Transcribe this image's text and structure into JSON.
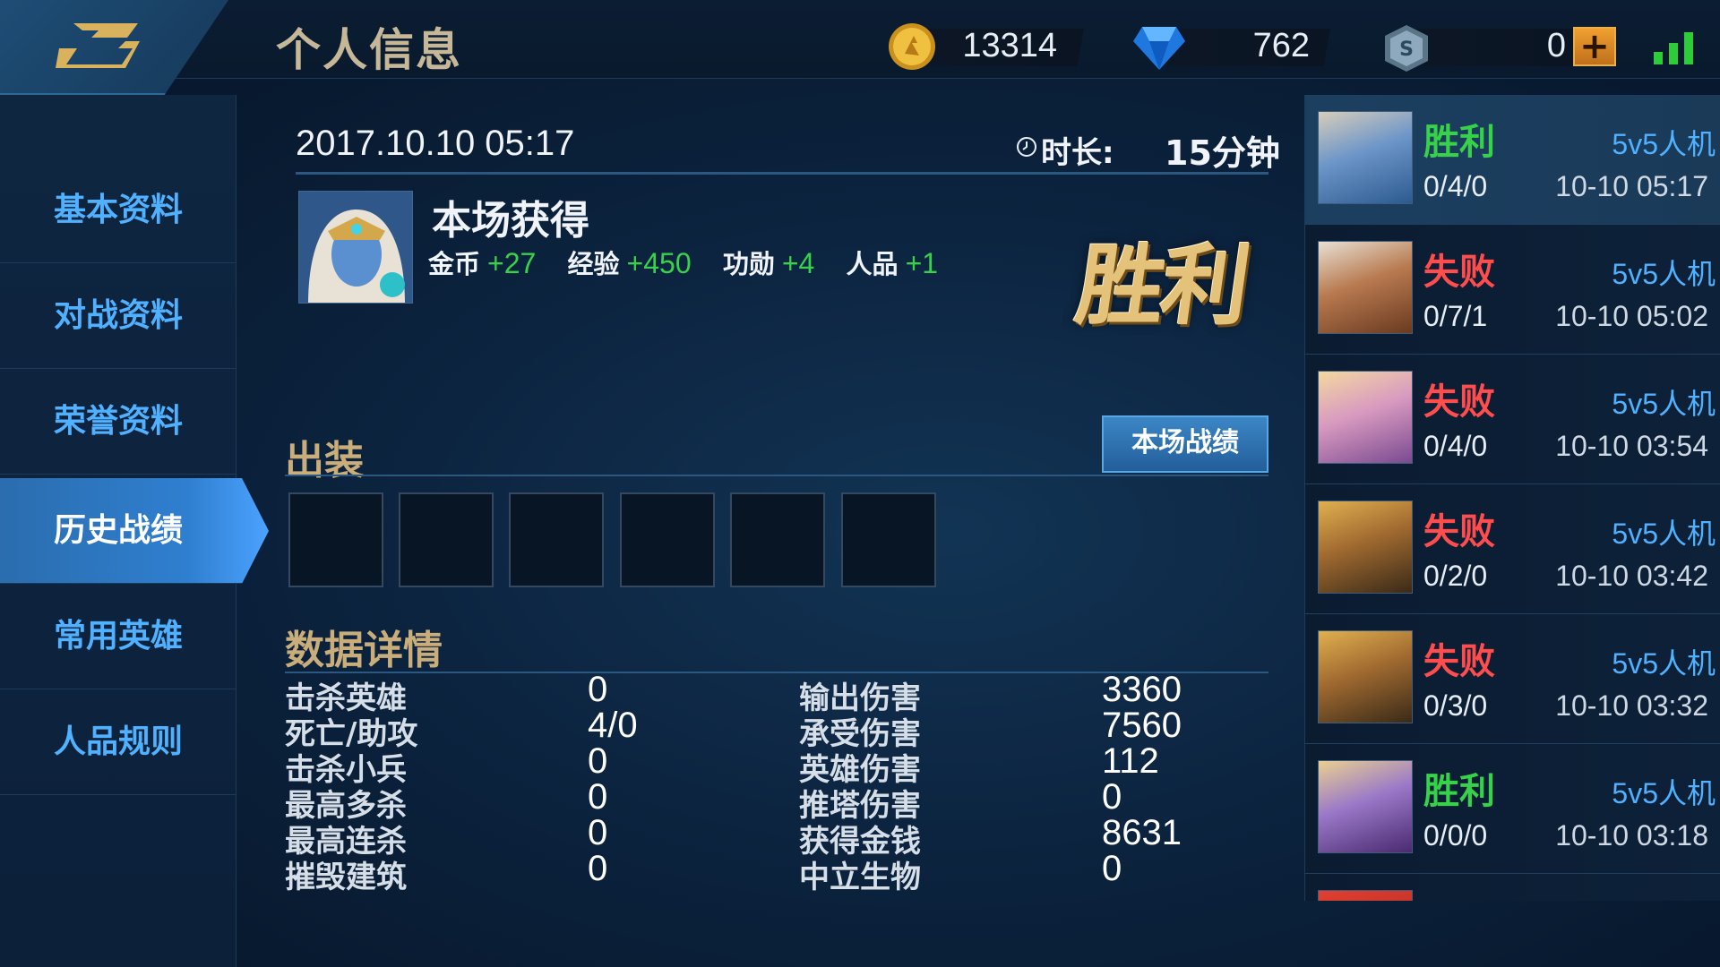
{
  "header": {
    "title": "个人信息",
    "gold": "13314",
    "diamonds": "762",
    "vouchers": "0",
    "add_label": "+"
  },
  "colors": {
    "win": "#37d14a",
    "loss": "#ff4d4d",
    "accent_blue": "#4fb1ff",
    "gold_title": "#c9ad7a"
  },
  "nav": {
    "items": [
      {
        "label": "基本资料"
      },
      {
        "label": "对战资料"
      },
      {
        "label": "荣誉资料"
      },
      {
        "label": "历史战绩"
      },
      {
        "label": "常用英雄"
      },
      {
        "label": "人品规则"
      }
    ],
    "active_index": 3
  },
  "match": {
    "datetime": "2017.10.10 05:17",
    "duration_label": "时长:",
    "duration_value": "15分钟",
    "gains_title": "本场获得",
    "gains": [
      {
        "label": "金币",
        "value": "+27"
      },
      {
        "label": "经验",
        "value": "+450"
      },
      {
        "label": "功勋",
        "value": "+4"
      },
      {
        "label": "人品",
        "value": "+1"
      }
    ],
    "result_stamp": "胜利",
    "equipment_title": "出装",
    "stats_button": "本场战绩",
    "details_title": "数据详情",
    "stats_left": [
      {
        "label": "击杀英雄",
        "value": "0"
      },
      {
        "label": "死亡/助攻",
        "value": "4/0"
      },
      {
        "label": "击杀小兵",
        "value": "0"
      },
      {
        "label": "最高多杀",
        "value": "0"
      },
      {
        "label": "最高连杀",
        "value": "0"
      },
      {
        "label": "摧毁建筑",
        "value": "0"
      }
    ],
    "stats_right": [
      {
        "label": "输出伤害",
        "value": "3360"
      },
      {
        "label": "承受伤害",
        "value": "7560"
      },
      {
        "label": "英雄伤害",
        "value": "112"
      },
      {
        "label": "推塔伤害",
        "value": "0"
      },
      {
        "label": "获得金钱",
        "value": "8631"
      },
      {
        "label": "中立生物",
        "value": "0"
      }
    ]
  },
  "history": [
    {
      "result": "胜利",
      "win": true,
      "mode": "5v5人机",
      "kda": "0/4/0",
      "time": "10-10 05:17",
      "selected": true
    },
    {
      "result": "失败",
      "win": false,
      "mode": "5v5人机",
      "kda": "0/7/1",
      "time": "10-10 05:02"
    },
    {
      "result": "失败",
      "win": false,
      "mode": "5v5人机",
      "kda": "0/4/0",
      "time": "10-10 03:54"
    },
    {
      "result": "失败",
      "win": false,
      "mode": "5v5人机",
      "kda": "0/2/0",
      "time": "10-10 03:42"
    },
    {
      "result": "失败",
      "win": false,
      "mode": "5v5人机",
      "kda": "0/3/0",
      "time": "10-10 03:32"
    },
    {
      "result": "胜利",
      "win": true,
      "mode": "5v5人机",
      "kda": "0/0/0",
      "time": "10-10 03:18"
    }
  ]
}
